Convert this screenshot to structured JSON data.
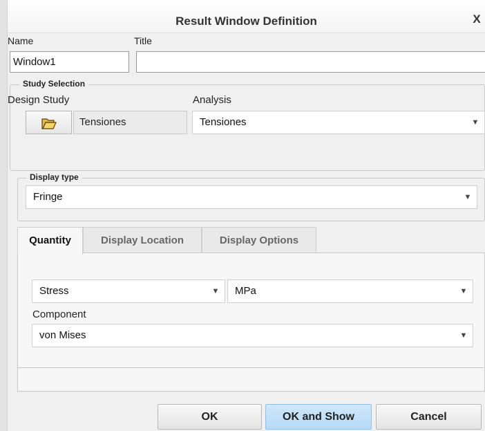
{
  "dialog": {
    "title": "Result Window Definition",
    "close_glyph": "X"
  },
  "name": {
    "label": "Name",
    "value": "Window1"
  },
  "title_field": {
    "label": "Title",
    "value": ""
  },
  "study_selection": {
    "legend": "Study Selection",
    "design_study_label": "Design Study",
    "design_study_value": "Tensiones",
    "analysis_label": "Analysis",
    "analysis_value": "Tensiones"
  },
  "display_type": {
    "legend": "Display type",
    "value": "Fringe"
  },
  "tabs": [
    {
      "label": "Quantity",
      "active": true
    },
    {
      "label": "Display Location",
      "active": false
    },
    {
      "label": "Display Options",
      "active": false
    }
  ],
  "quantity": {
    "quantity_value": "Stress",
    "unit_value": "MPa",
    "component_label": "Component",
    "component_value": "von Mises"
  },
  "buttons": {
    "ok": "OK",
    "ok_and_show": "OK and Show",
    "cancel": "Cancel"
  },
  "icons": {
    "dropdown": "chevron-down-icon",
    "open_folder": "open-folder-icon",
    "close": "close-icon"
  },
  "colors": {
    "primary_button": "#b6daf7",
    "background": "#f0f0f0"
  }
}
